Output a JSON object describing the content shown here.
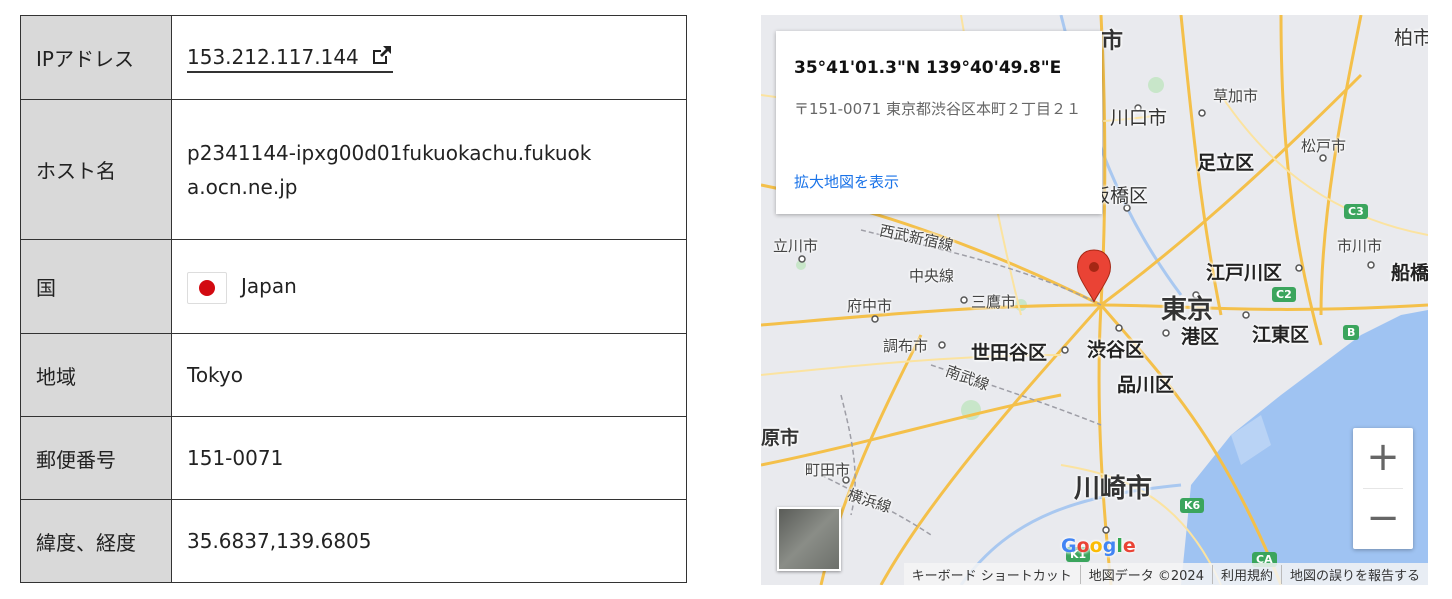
{
  "table": {
    "rows": [
      {
        "label": "IPアドレス",
        "value": "153.212.117.144"
      },
      {
        "label": "ホスト名",
        "value": "p2341144-ipxg00d01fukuokachu.fukuoka.ocn.ne.jp"
      },
      {
        "label": "国",
        "value": "Japan"
      },
      {
        "label": "地域",
        "value": "Tokyo"
      },
      {
        "label": "郵便番号",
        "value": "151-0071"
      },
      {
        "label": "緯度、経度",
        "value": "35.6837,139.6805"
      }
    ],
    "external_link_icon": "external-link-icon",
    "flag_icon": "japan-flag-icon"
  },
  "map": {
    "card": {
      "coords": "35°41'01.3\"N 139°40'49.8\"E",
      "address": "〒151-0071 東京都渋谷区本町２丁目２１",
      "link": "拡大地図を表示"
    },
    "places": {
      "p1": "市",
      "p2": "柏市",
      "p3": "草加市",
      "p4": "川口市",
      "p5": "松戸市",
      "p6": "足立区",
      "p7": "板橋区",
      "p8": "立川市",
      "p9": "西武新宿線",
      "p10": "市川市",
      "p11": "江戸川区",
      "p12": "船橋",
      "p13": "中央線",
      "p14": "府中市",
      "p15": "三鷹市",
      "p16": "東京",
      "p17": "港区",
      "p18": "江東区",
      "p19": "調布市",
      "p20": "世田谷区",
      "p21": "渋谷区",
      "p22": "南武線",
      "p23": "品川区",
      "p24": "原市",
      "p25": "町田市",
      "p26": "横浜線",
      "p27": "川崎市"
    },
    "badges": {
      "c3": "C3",
      "c2": "C2",
      "b": "B",
      "k6": "K6",
      "k1": "K1",
      "ca": "CA"
    },
    "google": "Google",
    "attribution": [
      "キーボード ショートカット",
      "地図データ ©2024",
      "利用規約",
      "地図の誤りを報告する"
    ],
    "zoom_in": "+",
    "zoom_out": "−"
  }
}
